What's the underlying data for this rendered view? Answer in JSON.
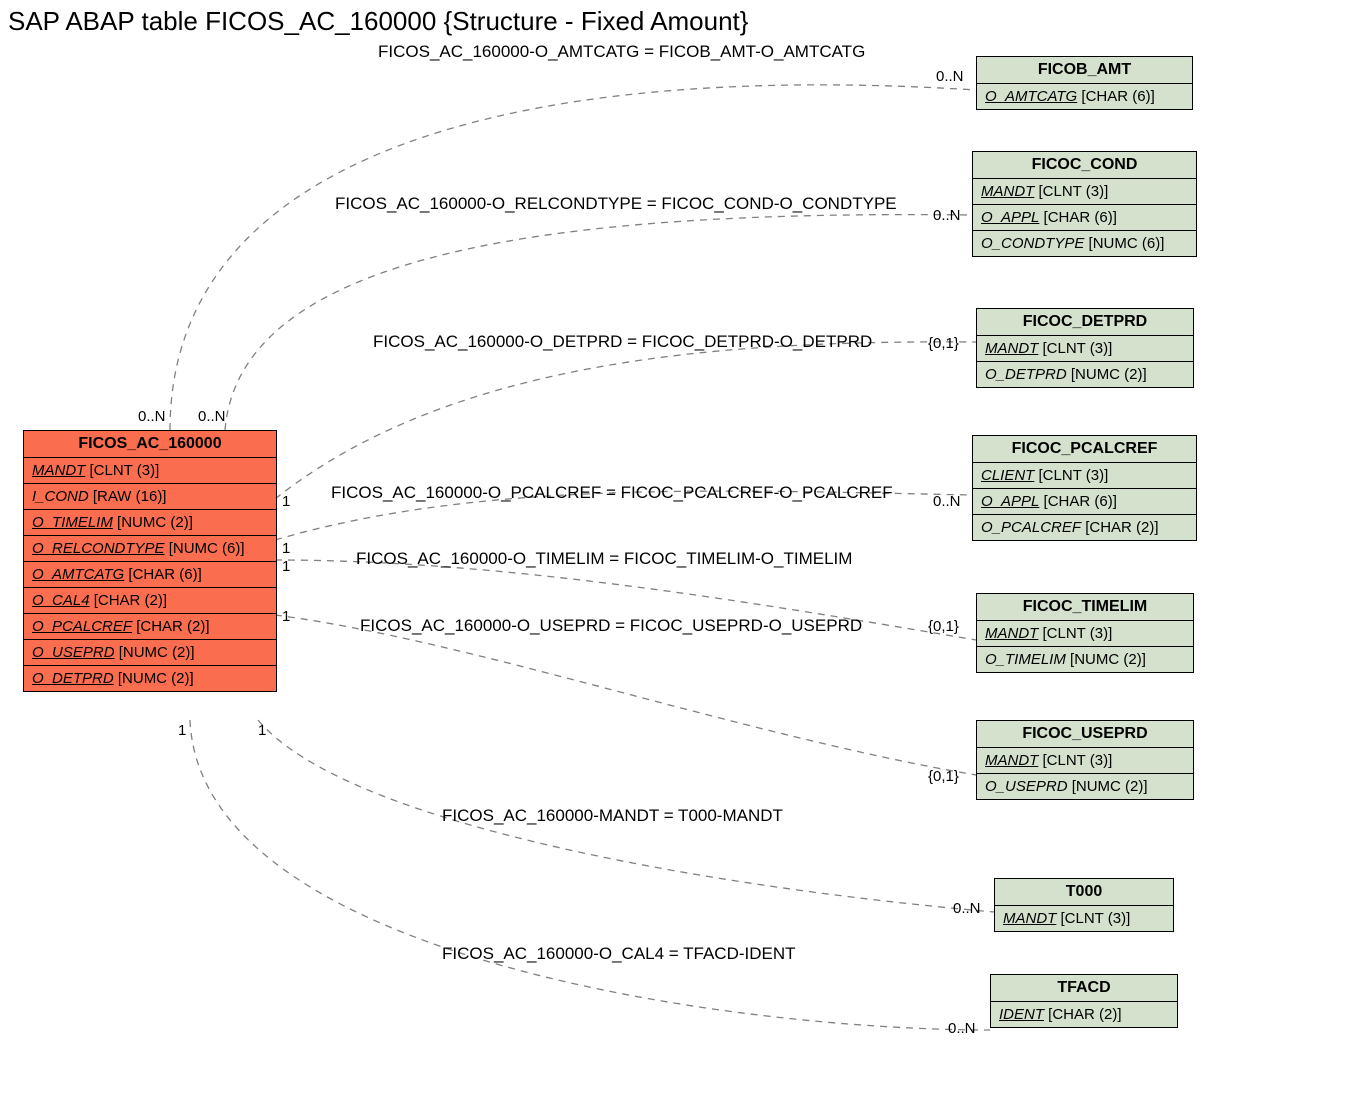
{
  "title": "SAP ABAP table FICOS_AC_160000 {Structure - Fixed Amount}",
  "main": {
    "name": "FICOS_AC_160000",
    "fields": [
      {
        "n": "MANDT",
        "t": "[CLNT (3)]",
        "u": true
      },
      {
        "n": "I_COND",
        "t": "[RAW (16)]",
        "u": false
      },
      {
        "n": "O_TIMELIM",
        "t": "[NUMC (2)]",
        "u": true
      },
      {
        "n": "O_RELCONDTYPE",
        "t": "[NUMC (6)]",
        "u": true
      },
      {
        "n": "O_AMTCATG",
        "t": "[CHAR (6)]",
        "u": true
      },
      {
        "n": "O_CAL4",
        "t": "[CHAR (2)]",
        "u": true
      },
      {
        "n": "O_PCALCREF",
        "t": "[CHAR (2)]",
        "u": true
      },
      {
        "n": "O_USEPRD",
        "t": "[NUMC (2)]",
        "u": true
      },
      {
        "n": "O_DETPRD",
        "t": "[NUMC (2)]",
        "u": true
      }
    ]
  },
  "refs": [
    {
      "name": "FICOB_AMT",
      "fields": [
        {
          "n": "O_AMTCATG",
          "t": "[CHAR (6)]",
          "u": true
        }
      ]
    },
    {
      "name": "FICOC_COND",
      "fields": [
        {
          "n": "MANDT",
          "t": "[CLNT (3)]",
          "u": true
        },
        {
          "n": "O_APPL",
          "t": "[CHAR (6)]",
          "u": true
        },
        {
          "n": "O_CONDTYPE",
          "t": "[NUMC (6)]",
          "u": false
        }
      ]
    },
    {
      "name": "FICOC_DETPRD",
      "fields": [
        {
          "n": "MANDT",
          "t": "[CLNT (3)]",
          "u": true
        },
        {
          "n": "O_DETPRD",
          "t": "[NUMC (2)]",
          "u": false
        }
      ]
    },
    {
      "name": "FICOC_PCALCREF",
      "fields": [
        {
          "n": "CLIENT",
          "t": "[CLNT (3)]",
          "u": true
        },
        {
          "n": "O_APPL",
          "t": "[CHAR (6)]",
          "u": true
        },
        {
          "n": "O_PCALCREF",
          "t": "[CHAR (2)]",
          "u": false
        }
      ]
    },
    {
      "name": "FICOC_TIMELIM",
      "fields": [
        {
          "n": "MANDT",
          "t": "[CLNT (3)]",
          "u": true
        },
        {
          "n": "O_TIMELIM",
          "t": "[NUMC (2)]",
          "u": false
        }
      ]
    },
    {
      "name": "FICOC_USEPRD",
      "fields": [
        {
          "n": "MANDT",
          "t": "[CLNT (3)]",
          "u": true
        },
        {
          "n": "O_USEPRD",
          "t": "[NUMC (2)]",
          "u": false
        }
      ]
    },
    {
      "name": "T000",
      "fields": [
        {
          "n": "MANDT",
          "t": "[CLNT (3)]",
          "u": true
        }
      ]
    },
    {
      "name": "TFACD",
      "fields": [
        {
          "n": "IDENT",
          "t": "[CHAR (2)]",
          "u": true
        }
      ]
    }
  ],
  "rels": [
    {
      "label": "FICOS_AC_160000-O_AMTCATG = FICOB_AMT-O_AMTCATG"
    },
    {
      "label": "FICOS_AC_160000-O_RELCONDTYPE = FICOC_COND-O_CONDTYPE"
    },
    {
      "label": "FICOS_AC_160000-O_DETPRD = FICOC_DETPRD-O_DETPRD"
    },
    {
      "label": "FICOS_AC_160000-O_PCALCREF = FICOC_PCALCREF-O_PCALCREF"
    },
    {
      "label": "FICOS_AC_160000-O_TIMELIM = FICOC_TIMELIM-O_TIMELIM"
    },
    {
      "label": "FICOS_AC_160000-O_USEPRD = FICOC_USEPRD-O_USEPRD"
    },
    {
      "label": "FICOS_AC_160000-MANDT = T000-MANDT"
    },
    {
      "label": "FICOS_AC_160000-O_CAL4 = TFACD-IDENT"
    }
  ],
  "cards": {
    "left": [
      "0..N",
      "0..N",
      "1",
      "1",
      "1",
      "1",
      "1",
      "1"
    ],
    "right": [
      "0..N",
      "0..N",
      "{0,1}",
      "0..N",
      "{0,1}",
      "{0,1}",
      "0..N",
      "0..N"
    ]
  }
}
